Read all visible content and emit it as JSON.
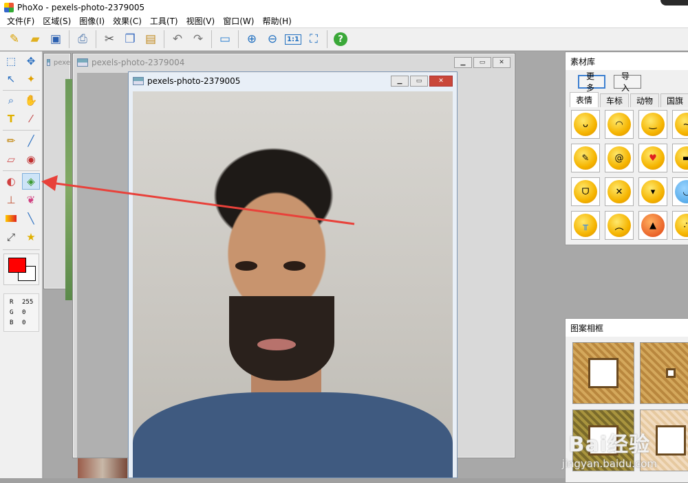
{
  "app": {
    "title": "PhoXo - pexels-photo-2379005"
  },
  "menu": [
    "文件(F)",
    "区域(S)",
    "图像(I)",
    "效果(C)",
    "工具(T)",
    "视图(V)",
    "窗口(W)",
    "帮助(H)"
  ],
  "toolbar": {
    "icons": [
      "new-icon",
      "open-icon",
      "save-icon",
      "scan-icon",
      "cut-icon",
      "copy-icon",
      "paste-icon",
      "undo-icon",
      "redo-icon",
      "screen-capture-icon",
      "zoom-in-icon",
      "zoom-out-icon",
      "actual-size-icon",
      "fit-window-icon",
      "help-icon"
    ],
    "actual_size_label": "1:1",
    "help_label": "?"
  },
  "tools": {
    "selected": "color-replace-tool",
    "text_tool_label": "T"
  },
  "colors": {
    "foreground": "#ff0000",
    "background": "#ffffff"
  },
  "rgb": {
    "r_label": "R",
    "r_value": "255",
    "g_label": "G",
    "g_value": "0",
    "b_label": "B",
    "b_value": "0"
  },
  "windows": {
    "back_title": "pexe",
    "middle_title": "pexels-photo-2379004",
    "front_title": "pexels-photo-2379005"
  },
  "library": {
    "title": "素材库",
    "more_button": "更多",
    "import_button": "导入",
    "tabs": [
      "表情",
      "车标",
      "动物",
      "国旗"
    ],
    "active_tab": "表情"
  },
  "frames_panel": {
    "title": "图案相框"
  },
  "watermark": {
    "brand": "Bai经验",
    "url": "jingyan.baidu.com"
  },
  "accent": {
    "annotation": "#e8413a",
    "selection": "#cde4f7"
  }
}
